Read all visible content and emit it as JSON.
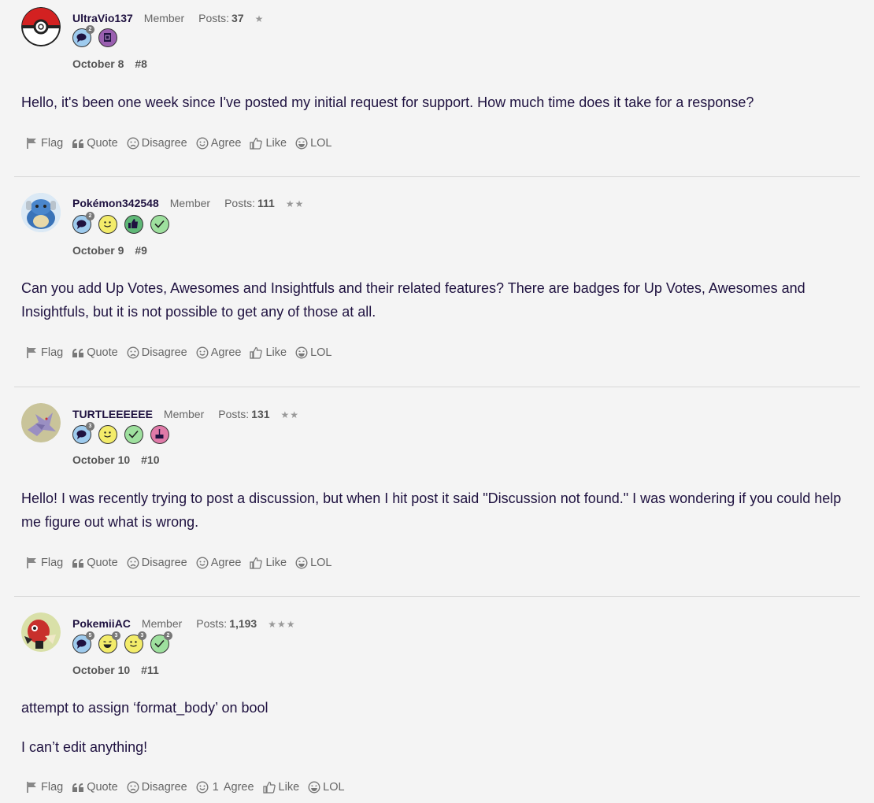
{
  "actions": {
    "flag": "Flag",
    "quote": "Quote",
    "disagree": "Disagree",
    "agree": "Agree",
    "like": "Like",
    "lol": "LOL"
  },
  "comments": [
    {
      "username": "UltraVio137",
      "role": "Member",
      "posts_label": "Posts:",
      "posts": "37",
      "rank": "★",
      "badges": [
        {
          "icon": "comment-badge-icon",
          "count": "2"
        },
        {
          "icon": "book-badge-icon",
          "count": ""
        }
      ],
      "date": "October 8",
      "post_number": "#8",
      "body": [
        "Hello, it's been one week since I've posted my initial request for support. How much time does it take for a response?"
      ],
      "agree_count": ""
    },
    {
      "username": "Pokémon342548",
      "role": "Member",
      "posts_label": "Posts:",
      "posts": "111",
      "rank": "★★",
      "badges": [
        {
          "icon": "comment-badge-icon",
          "count": "2"
        },
        {
          "icon": "smile-badge-icon",
          "count": ""
        },
        {
          "icon": "thumbs-up-badge-icon",
          "count": ""
        },
        {
          "icon": "check-badge-icon",
          "count": ""
        }
      ],
      "date": "October 9",
      "post_number": "#9",
      "body": [
        "Can you add Up Votes, Awesomes and Insightfuls and their related features? There are badges for Up Votes, Awesomes and Insightfuls, but it is not possible to get any of those at all."
      ],
      "agree_count": ""
    },
    {
      "username": "TURTLEEEEEE",
      "role": "Member",
      "posts_label": "Posts:",
      "posts": "131",
      "rank": "★★",
      "badges": [
        {
          "icon": "comment-badge-icon",
          "count": "3"
        },
        {
          "icon": "smile-badge-icon",
          "count": ""
        },
        {
          "icon": "check-badge-icon",
          "count": ""
        },
        {
          "icon": "cake-badge-icon",
          "count": ""
        }
      ],
      "date": "October 10",
      "post_number": "#10",
      "body": [
        "Hello! I was recently trying to post a discussion, but when I hit post it said \"Discussion not found.\" I was wondering if you could help me figure out what is wrong."
      ],
      "agree_count": ""
    },
    {
      "username": "PokemiiAC",
      "role": "Member",
      "posts_label": "Posts:",
      "posts": "1,193",
      "rank": "★★★",
      "badges": [
        {
          "icon": "comment-badge-icon",
          "count": "5"
        },
        {
          "icon": "lol-badge-icon",
          "count": "3"
        },
        {
          "icon": "smile-badge-icon",
          "count": "3"
        },
        {
          "icon": "check-badge-icon",
          "count": "2"
        }
      ],
      "date": "October 10",
      "post_number": "#11",
      "body": [
        "attempt to assign ‘format_body’ on bool",
        "I can’t edit anything!"
      ],
      "agree_count": "1"
    }
  ]
}
